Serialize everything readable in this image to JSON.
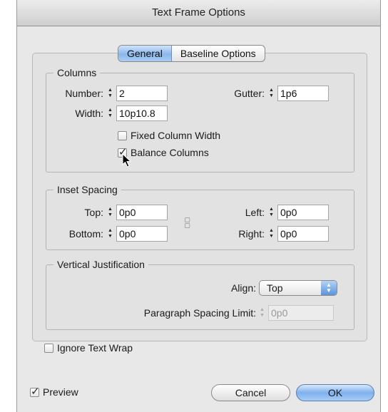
{
  "window": {
    "title": "Text Frame Options"
  },
  "tabs": [
    {
      "label": "General",
      "active": true
    },
    {
      "label": "Baseline Options",
      "active": false
    }
  ],
  "columns": {
    "legend": "Columns",
    "number_label": "Number:",
    "number_value": "2",
    "gutter_label": "Gutter:",
    "gutter_value": "1p6",
    "width_label": "Width:",
    "width_value": "10p10.8",
    "fixed_width_label": "Fixed Column Width",
    "fixed_width_checked": false,
    "balance_label": "Balance Columns",
    "balance_checked": true
  },
  "inset": {
    "legend": "Inset Spacing",
    "top_label": "Top:",
    "top_value": "0p0",
    "bottom_label": "Bottom:",
    "bottom_value": "0p0",
    "left_label": "Left:",
    "left_value": "0p0",
    "right_label": "Right:",
    "right_value": "0p0"
  },
  "vertical": {
    "legend": "Vertical Justification",
    "align_label": "Align:",
    "align_value": "Top",
    "para_limit_label": "Paragraph Spacing Limit:",
    "para_limit_value": "0p0"
  },
  "ignore_wrap": {
    "label": "Ignore Text Wrap",
    "checked": false
  },
  "footer": {
    "preview_label": "Preview",
    "preview_checked": true,
    "cancel_label": "Cancel",
    "ok_label": "OK"
  }
}
